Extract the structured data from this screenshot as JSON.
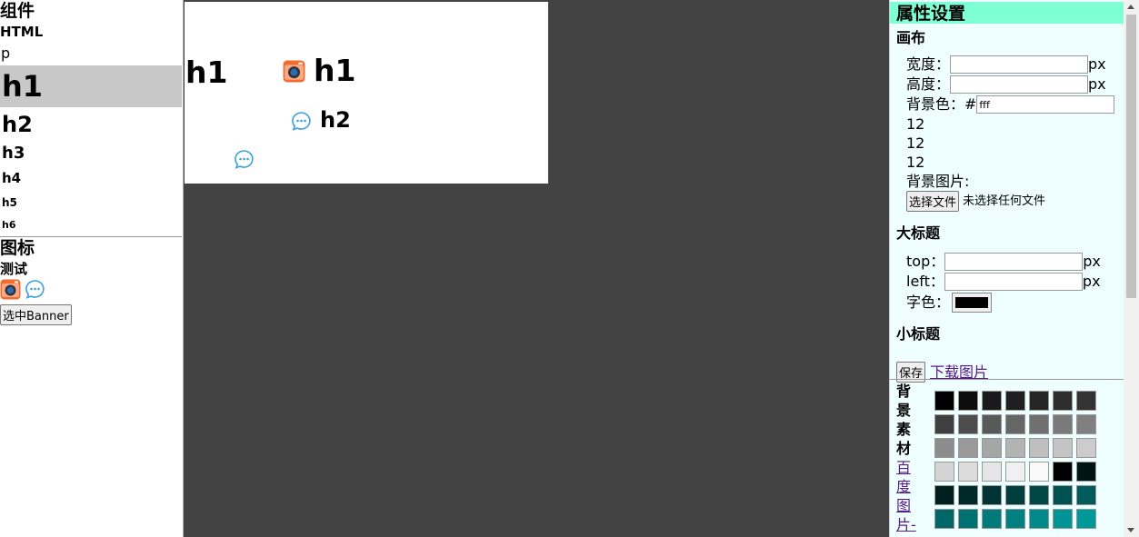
{
  "left": {
    "components_title": "组件",
    "components": [
      "HTML",
      "p",
      "h1",
      "h2",
      "h3",
      "h4",
      "h5",
      "h6"
    ],
    "icons_title": "图标",
    "test_label": "测试",
    "select_banner_button": "选中Banner"
  },
  "banner": {
    "h1_a": "h1",
    "h1_b": "h1",
    "h2": "h2"
  },
  "right": {
    "title": "属性设置",
    "canvas": {
      "title": "画布",
      "width_label": "宽度：",
      "width_value": "",
      "width_unit": "px",
      "height_label": "高度：",
      "height_value": "",
      "height_unit": "px",
      "bg_color_label": "背景色：#",
      "bg_color_value": "fff",
      "numbers": [
        "12",
        "12",
        "12"
      ],
      "bg_image_label": "背景图片:",
      "choose_file_button": "选择文件",
      "no_file_text": "未选择任何文件"
    },
    "big_title": {
      "title": "大标题",
      "top_label": "top：",
      "top_value": "",
      "top_unit": "px",
      "left_label": "left：",
      "left_value": "",
      "left_unit": "px",
      "font_color_label": "字色：",
      "font_color": "#000000"
    },
    "small_title": {
      "title": "小标题"
    },
    "save_button": "保存",
    "download_link": "下载图片",
    "bg_material_label": [
      "背",
      "景",
      "素",
      "材"
    ],
    "baidu_link": [
      "百",
      "度",
      "图",
      "片-"
    ],
    "palette": [
      "#000000",
      "#0d0d0d",
      "#1a1a1a",
      "#1f1f1f",
      "#262626",
      "#2e2e2e",
      "#333333",
      "#404040",
      "#4d4d4d",
      "#595959",
      "#666666",
      "#707070",
      "#7a7a7a",
      "#808080",
      "#8c8c8c",
      "#999999",
      "#a6a6a6",
      "#b3b3b3",
      "#bfbfbf",
      "#c4c4c4",
      "#cccccc",
      "#d4d4d4",
      "#dcdcdc",
      "#e6e6e6",
      "#f0f0f0",
      "#fafafa",
      "#000000",
      "#001414",
      "#001f1f",
      "#002929",
      "#003333",
      "#003d3d",
      "#004747",
      "#005252",
      "#005c5c",
      "#006666",
      "#007070",
      "#007a7a",
      "#008080",
      "#008a8a",
      "#009494",
      "#009999"
    ]
  }
}
